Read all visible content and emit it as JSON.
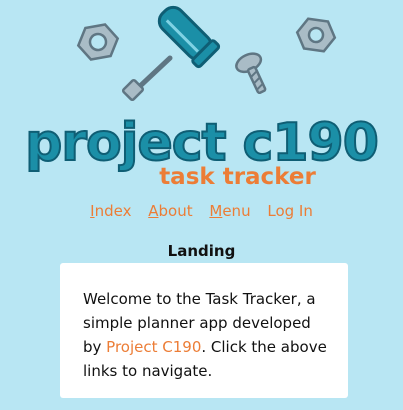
{
  "logo": {
    "title": "project c190",
    "subtitle": "task tracker",
    "icons": [
      "screwdriver-icon",
      "hex-nut-icon",
      "hex-nut-icon",
      "screw-icon"
    ]
  },
  "nav": {
    "items": [
      {
        "access_key": "I",
        "rest": "ndex"
      },
      {
        "access_key": "A",
        "rest": "bout"
      },
      {
        "access_key": "M",
        "rest": "enu"
      },
      {
        "access_key": "",
        "rest": "Log In"
      }
    ]
  },
  "page": {
    "heading": "Landing",
    "intro_before": "Welcome to the Task Tracker, a simple planner app developed by ",
    "intro_brand": "Project C190",
    "intro_after": ". Click the above links to navigate."
  },
  "colors": {
    "background": "#b8e6f3",
    "accent": "#ec7d36",
    "logo_teal": "#1b8fa7",
    "card": "#ffffff"
  }
}
